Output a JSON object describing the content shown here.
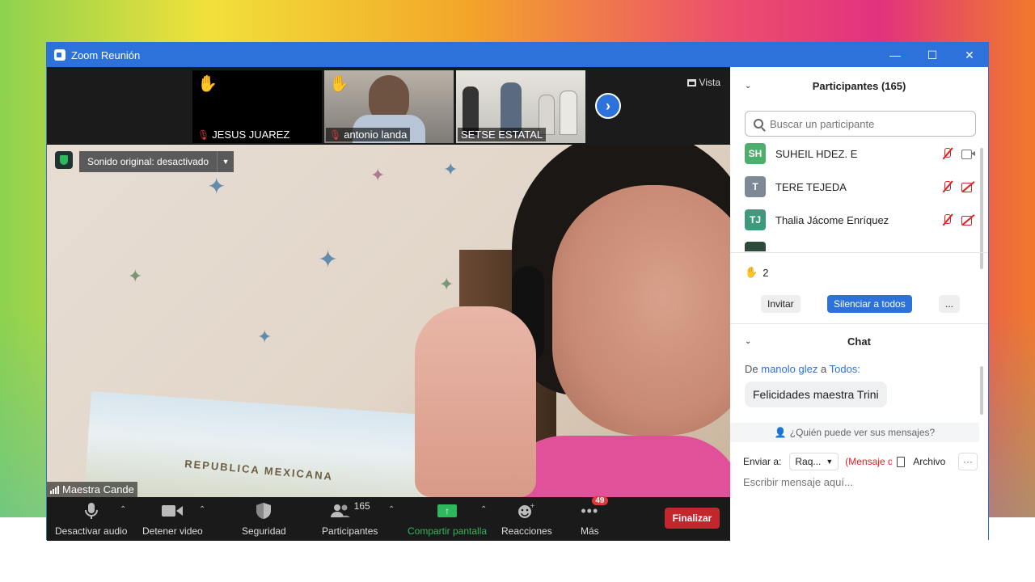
{
  "window": {
    "title": "Zoom Reunión",
    "min": "—",
    "max": "☐",
    "close": "✕"
  },
  "thumbnails": [
    {
      "name": "JESUS JUAREZ",
      "hand": true,
      "muted": true
    },
    {
      "name": "antonio landa",
      "hand": true,
      "muted": true
    },
    {
      "name": "SETSE ESTATAL",
      "hand": false,
      "muted": false
    }
  ],
  "vista_label": "Vista",
  "original_sound": "Sonido original: desactivado",
  "speaker_name": "Maestra Cande",
  "video_text": "REPUBLICA MEXICANA",
  "toolbar": {
    "audio": "Desactivar audio",
    "video": "Detener video",
    "security": "Seguridad",
    "participants": "Participantes",
    "participants_count": "165",
    "share": "Compartir pantalla",
    "reactions": "Reacciones",
    "more": "Más",
    "more_badge": "49",
    "end": "Finalizar"
  },
  "participants_panel": {
    "title": "Participantes (165)",
    "search_placeholder": "Buscar un participante",
    "rows": [
      {
        "initials": "SH",
        "name": "SUHEIL HDEZ. E",
        "color": "#4caf6d",
        "video_on": true
      },
      {
        "initials": "T",
        "name": "TERE TEJEDA",
        "color": "#7d8a96",
        "video_on": false
      },
      {
        "initials": "TJ",
        "name": "Thalia Jácome Enríquez",
        "color": "#3f9a7d",
        "video_on": false
      }
    ],
    "raised_hands": "2",
    "invite": "Invitar",
    "mute_all": "Silenciar a todos",
    "more": "..."
  },
  "chat": {
    "title": "Chat",
    "from_prefix": "De",
    "from_name": "manolo glez",
    "from_mid": "a",
    "to_name": "Todos:",
    "message": "Felicidades maestra Trini",
    "who_sees": "¿Quién puede ver sus mensajes?",
    "send_to_label": "Enviar a:",
    "send_to_value": "Raq...",
    "send_note": "(Mensaje d",
    "file_label": "Archivo",
    "more": "···",
    "input_placeholder": "Escribir mensaje aquí..."
  }
}
